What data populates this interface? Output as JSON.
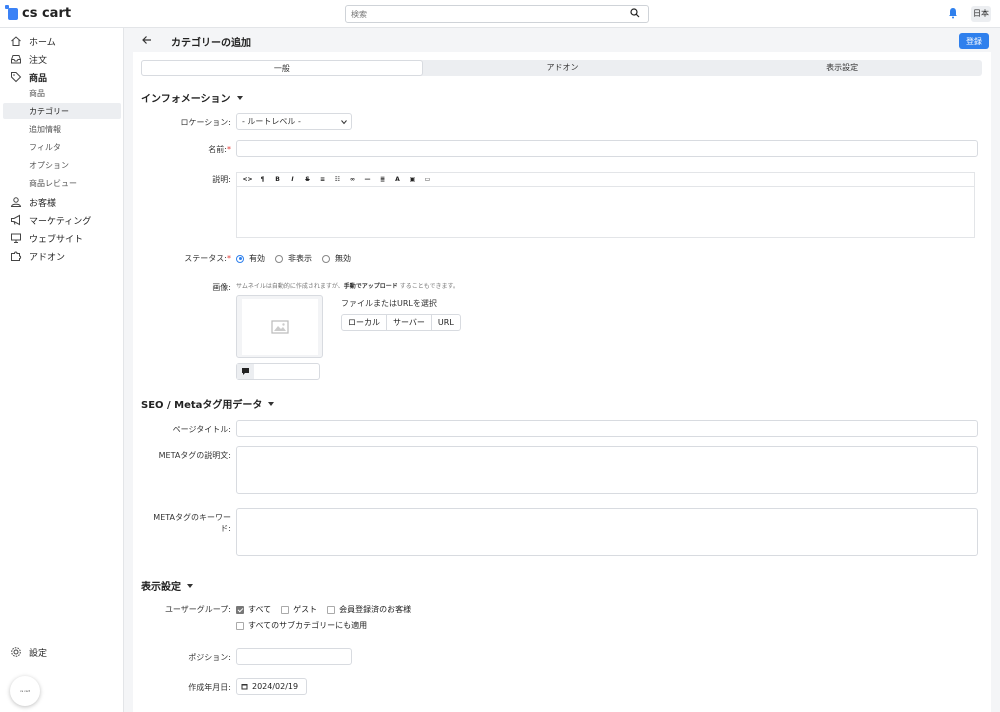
{
  "topbar": {
    "logo_text": "cs cart",
    "search_placeholder": "検索",
    "language": "日本"
  },
  "sidebar": {
    "items": [
      {
        "label": "ホーム",
        "icon": "home-icon"
      },
      {
        "label": "注文",
        "icon": "inbox-icon"
      },
      {
        "label": "商品",
        "icon": "tag-icon"
      },
      {
        "label": "お客様",
        "icon": "user-icon"
      },
      {
        "label": "マーケティング",
        "icon": "megaphone-icon"
      },
      {
        "label": "ウェブサイト",
        "icon": "monitor-icon"
      },
      {
        "label": "アドオン",
        "icon": "puzzle-icon"
      }
    ],
    "sub_items": [
      "商品",
      "カテゴリー",
      "追加情報",
      "フィルタ",
      "オプション",
      "商品レビュー"
    ],
    "settings_label": "設定",
    "avatar_text": "cs cart"
  },
  "header": {
    "title": "カテゴリーの追加",
    "save_label": "登録"
  },
  "tabs": [
    "一般",
    "アドオン",
    "表示設定"
  ],
  "info_section": {
    "title": "インフォメーション",
    "location_label": "ロケーション:",
    "location_value": "- ルートレベル -",
    "name_label": "名前:",
    "description_label": "説明:",
    "toolbar": [
      "<>",
      "¶",
      "B",
      "I",
      "S",
      "≡",
      "☷",
      "∞",
      "—",
      "≣",
      "A",
      "▣",
      "▭"
    ],
    "status_label": "ステータス:",
    "status_options": [
      "有効",
      "非表示",
      "無効"
    ],
    "image_label": "画像:",
    "image_hint_pre": "サムネイルは自動的に作成されますが、",
    "image_hint_bold": "手動でアップロード",
    "image_hint_post": " することもできます。",
    "upload_title": "ファイルまたはURLを選択",
    "upload_buttons": [
      "ローカル",
      "サーバー",
      "URL"
    ]
  },
  "seo_section": {
    "title": "SEO / Metaタグ用データ",
    "page_title_label": "ページタイトル:",
    "meta_desc_label": "METAタグの説明文:",
    "meta_keywords_label_1": "METAタグのキーワー",
    "meta_keywords_label_2": "ド:"
  },
  "display_section": {
    "title": "表示設定",
    "usergroup_label": "ユーザーグループ:",
    "usergroups": [
      "すべて",
      "ゲスト",
      "会員登録済のお客様"
    ],
    "apply_subcats": "すべてのサブカテゴリーにも適用",
    "position_label": "ポジション:",
    "created_label": "作成年月日:",
    "created_value": "2024/02/19"
  },
  "colors": {
    "primary": "#2f80ed",
    "accent_logo": "#3b82f6",
    "required": "#e53935"
  }
}
